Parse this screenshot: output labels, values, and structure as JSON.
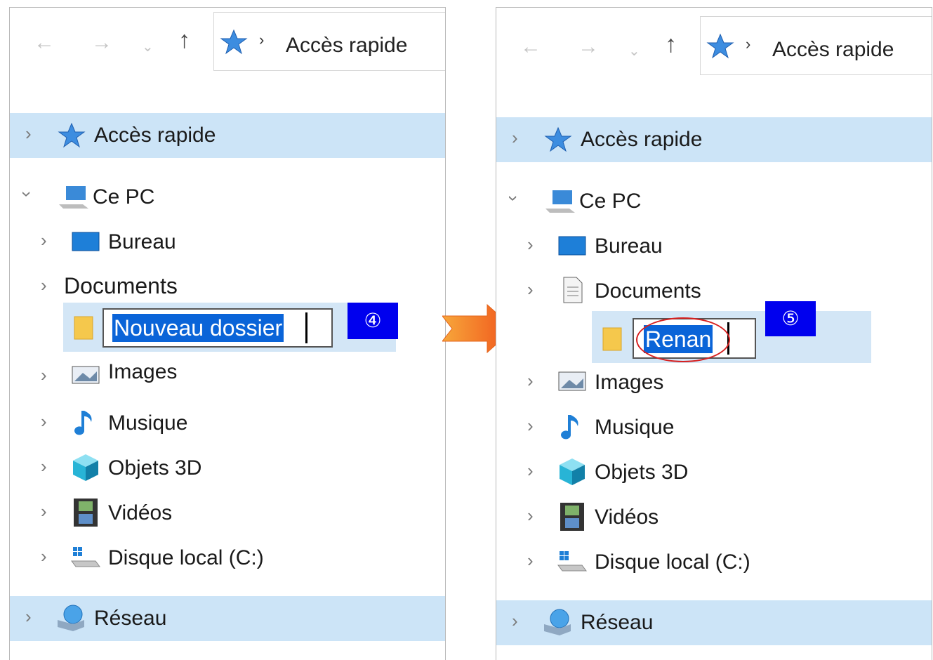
{
  "left": {
    "address": "Accès rapide",
    "quick_access": "Accès rapide",
    "this_pc": "Ce PC",
    "items": {
      "bureau": "Bureau",
      "documents": "Documents",
      "images": "Images",
      "musique": "Musique",
      "objets3d": "Objets 3D",
      "videos": "Vidéos",
      "disque": "Disque local (C:)"
    },
    "edit_value": "Nouveau dossier",
    "step_badge": "④",
    "network": "Réseau"
  },
  "right": {
    "address": "Accès rapide",
    "quick_access": "Accès rapide",
    "this_pc": "Ce PC",
    "items": {
      "bureau": "Bureau",
      "documents": "Documents",
      "images": "Images",
      "musique": "Musique",
      "objets3d": "Objets 3D",
      "videos": "Vidéos",
      "disque": "Disque local (C:)"
    },
    "edit_value": "Renan",
    "step_badge": "⑤",
    "network": "Réseau"
  },
  "colors": {
    "selection_row": "#cce4f7",
    "text_selection": "#0a64d8",
    "badge": "#0000ee",
    "highlight_circle": "#d62020",
    "arrow": "#f26a21"
  },
  "icons": {
    "back": "arrow-left-icon",
    "forward": "arrow-right-icon",
    "recent": "chevron-down-icon",
    "up": "arrow-up-icon",
    "star": "star-icon",
    "pc": "computer-icon",
    "desktop": "desktop-icon",
    "documents": "document-icon",
    "folder": "folder-icon",
    "images": "picture-icon",
    "music": "music-note-icon",
    "objects3d": "cube-icon",
    "videos": "film-icon",
    "drive": "drive-icon",
    "network": "network-icon"
  }
}
